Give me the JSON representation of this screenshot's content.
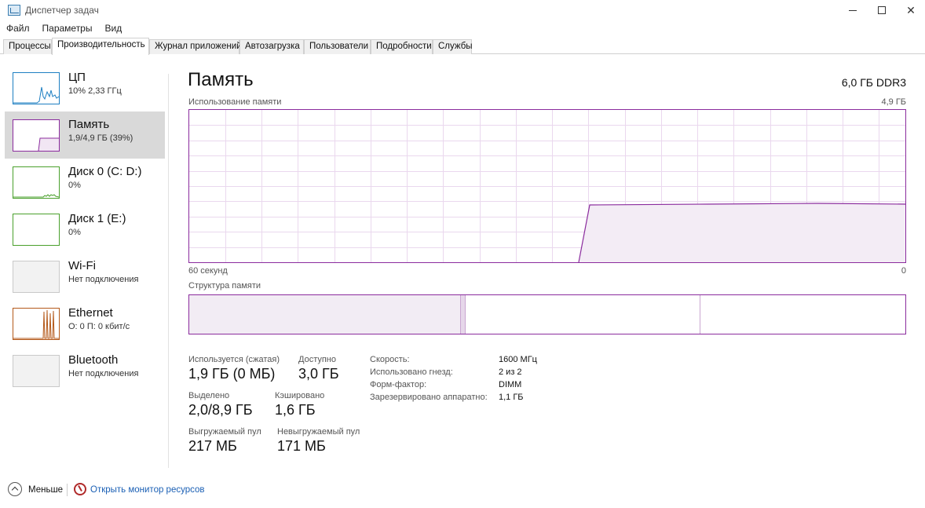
{
  "window": {
    "title": "Диспетчер задач"
  },
  "menu": [
    "Файл",
    "Параметры",
    "Вид"
  ],
  "tabs": [
    "Процессы",
    "Производительность",
    "Журнал приложений",
    "Автозагрузка",
    "Пользователи",
    "Подробности",
    "Службы"
  ],
  "sidebar": {
    "items": [
      {
        "title": "ЦП",
        "sub": "10% 2,33 ГГц",
        "color": "#1e7fc2"
      },
      {
        "title": "Память",
        "sub": "1,9/4,9 ГБ (39%)",
        "color": "#8b2c9e"
      },
      {
        "title": "Диск 0 (C: D:)",
        "sub": "0%",
        "color": "#4aa02c"
      },
      {
        "title": "Диск 1 (E:)",
        "sub": "0%",
        "color": "#4aa02c"
      },
      {
        "title": "Wi-Fi",
        "sub": "Нет подключения",
        "color": "#c9c9c9"
      },
      {
        "title": "Ethernet",
        "sub": "О: 0 П: 0 кбит/с",
        "color": "#b4591a"
      },
      {
        "title": "Bluetooth",
        "sub": "Нет подключения",
        "color": "#c9c9c9"
      }
    ]
  },
  "main": {
    "title": "Память",
    "spec": "6,0 ГБ DDR3",
    "graph_label": "Использование памяти",
    "graph_max": "4,9 ГБ",
    "time_left": "60 секунд",
    "time_right": "0",
    "composition_label": "Структура памяти",
    "accent": "#8b2c9e",
    "stats": {
      "in_use_label": "Используется (сжатая)",
      "in_use": "1,9 ГБ (0 МБ)",
      "available_label": "Доступно",
      "available": "3,0 ГБ",
      "committed_label": "Выделено",
      "committed": "2,0/8,9 ГБ",
      "cached_label": "Кэшировано",
      "cached": "1,6 ГБ",
      "paged_label": "Выгружаемый пул",
      "paged": "217 МБ",
      "nonpaged_label": "Невыгружаемый пул",
      "nonpaged": "171 МБ"
    },
    "props": [
      {
        "label": "Скорость:",
        "value": "1600 МГц"
      },
      {
        "label": "Использовано гнезд:",
        "value": "2 из 2"
      },
      {
        "label": "Форм-фактор:",
        "value": "DIMM"
      },
      {
        "label": "Зарезервировано аппаратно:",
        "value": "1,1 ГБ"
      }
    ]
  },
  "footer": {
    "less": "Меньше",
    "resource_monitor": "Открыть монитор ресурсов"
  }
}
